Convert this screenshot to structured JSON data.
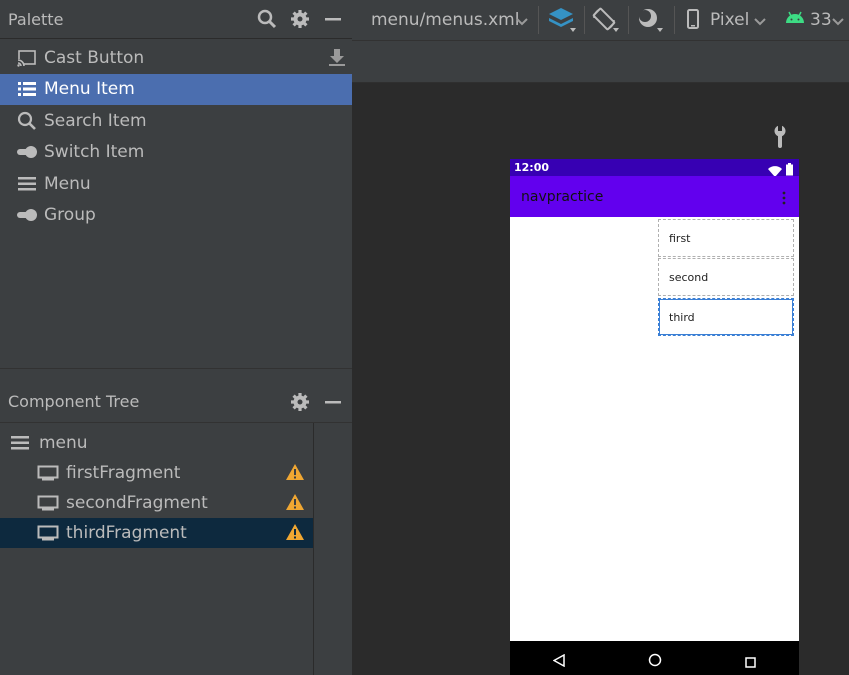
{
  "palette": {
    "title": "Palette",
    "items": [
      {
        "label": "Cast Button",
        "icon": "cast-icon"
      },
      {
        "label": "Menu Item",
        "icon": "menu-item-icon",
        "selected": true
      },
      {
        "label": "Search Item",
        "icon": "search-icon"
      },
      {
        "label": "Switch Item",
        "icon": "switch-icon"
      },
      {
        "label": "Menu",
        "icon": "menu-icon"
      },
      {
        "label": "Group",
        "icon": "group-icon"
      }
    ]
  },
  "component_tree": {
    "title": "Component Tree",
    "root": "menu",
    "children": [
      {
        "label": "firstFragment"
      },
      {
        "label": "secondFragment"
      },
      {
        "label": "thirdFragment",
        "selected": true
      }
    ]
  },
  "toolbar": {
    "file": "menu/menus.xml",
    "device": "Pixel",
    "api": "33"
  },
  "device": {
    "time": "12:00",
    "app_title": "navpractice",
    "menu_items": [
      "first",
      "second",
      "third"
    ]
  },
  "colors": {
    "accent": "#4b6eaf",
    "status_bar": "#3700b3",
    "app_bar": "#6200ee",
    "warning": "#f0a732",
    "android_green": "#3ddc84"
  }
}
